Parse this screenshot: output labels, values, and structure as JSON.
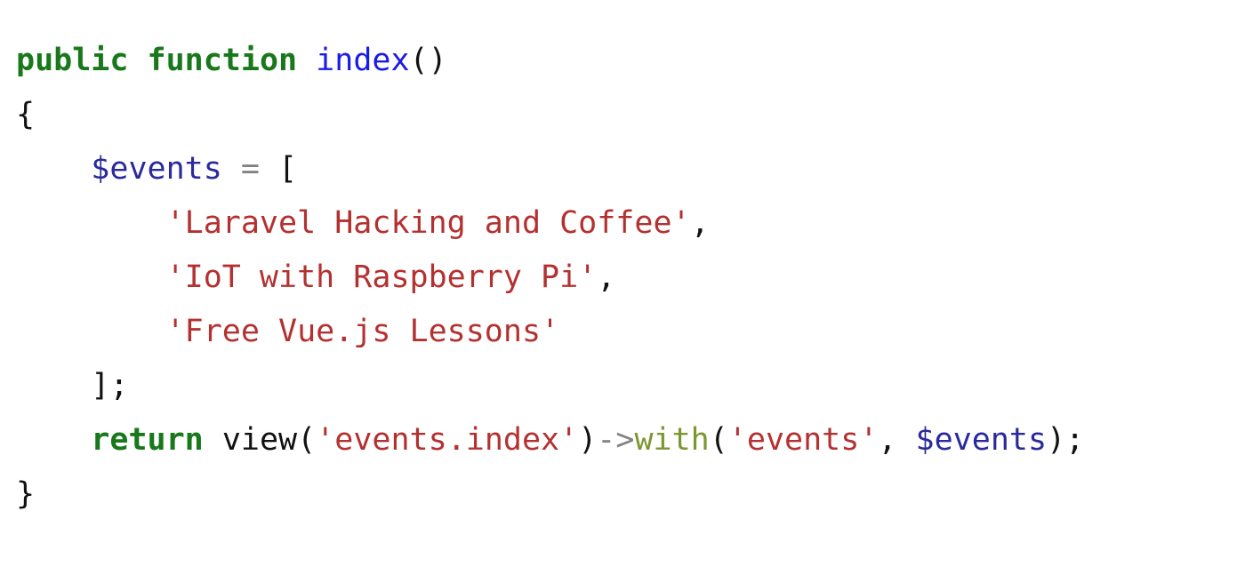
{
  "document": {
    "language": "php",
    "background_color": "#ffffff"
  },
  "palette": {
    "keyword": "#19781b",
    "function": "#1a1ae8",
    "variable": "#2a2a9c",
    "string": "#b43131",
    "operator": "#828282",
    "method": "#7d9630",
    "plain": "#111111"
  },
  "code": {
    "lines": [
      {
        "indent": "",
        "tokens": [
          {
            "text": "public",
            "type": "keyword"
          },
          {
            "text": " ",
            "type": "plain"
          },
          {
            "text": "function",
            "type": "keyword"
          },
          {
            "text": " ",
            "type": "plain"
          },
          {
            "text": "index",
            "type": "function"
          },
          {
            "text": "()",
            "type": "punct"
          }
        ]
      },
      {
        "indent": "",
        "tokens": [
          {
            "text": "{",
            "type": "punct"
          }
        ]
      },
      {
        "indent": "    ",
        "tokens": [
          {
            "text": "$events",
            "type": "variable"
          },
          {
            "text": " ",
            "type": "plain"
          },
          {
            "text": "=",
            "type": "operator"
          },
          {
            "text": " ",
            "type": "plain"
          },
          {
            "text": "[",
            "type": "punct"
          }
        ]
      },
      {
        "indent": "        ",
        "tokens": [
          {
            "text": "'Laravel Hacking and Coffee'",
            "type": "string"
          },
          {
            "text": ",",
            "type": "punct"
          }
        ]
      },
      {
        "indent": "        ",
        "tokens": [
          {
            "text": "'IoT with Raspberry Pi'",
            "type": "string"
          },
          {
            "text": ",",
            "type": "punct"
          }
        ]
      },
      {
        "indent": "        ",
        "tokens": [
          {
            "text": "'Free Vue.js Lessons'",
            "type": "string"
          }
        ]
      },
      {
        "indent": "    ",
        "tokens": [
          {
            "text": "];",
            "type": "punct"
          }
        ]
      },
      {
        "indent": "    ",
        "tokens": [
          {
            "text": "return",
            "type": "keyword"
          },
          {
            "text": " ",
            "type": "plain"
          },
          {
            "text": "view",
            "type": "plain"
          },
          {
            "text": "(",
            "type": "punct"
          },
          {
            "text": "'events.index'",
            "type": "string"
          },
          {
            "text": ")",
            "type": "punct"
          },
          {
            "text": "->",
            "type": "operator"
          },
          {
            "text": "with",
            "type": "method"
          },
          {
            "text": "(",
            "type": "punct"
          },
          {
            "text": "'events'",
            "type": "string"
          },
          {
            "text": ", ",
            "type": "punct"
          },
          {
            "text": "$events",
            "type": "variable"
          },
          {
            "text": ");",
            "type": "punct"
          }
        ]
      },
      {
        "indent": "",
        "tokens": [
          {
            "text": "}",
            "type": "punct"
          }
        ]
      }
    ]
  }
}
